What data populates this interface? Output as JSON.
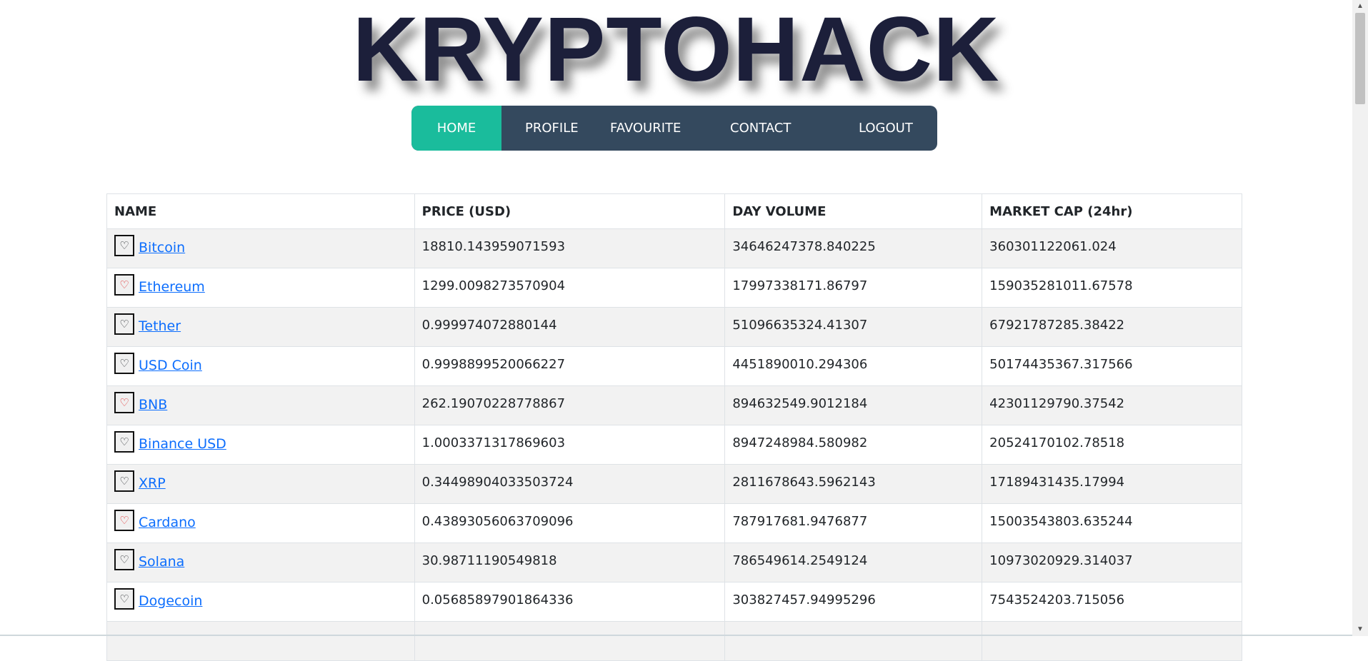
{
  "brand": {
    "logo_text": "KRYPTOHACK"
  },
  "nav": {
    "items": [
      {
        "label": "HOME",
        "active": true
      },
      {
        "label": "PROFILE",
        "active": false
      },
      {
        "label": "FAVOURITE",
        "active": false
      },
      {
        "label": "CONTACT",
        "active": false
      },
      {
        "label": "LOGOUT",
        "active": false
      }
    ],
    "bg_color": "#34495e",
    "active_color": "#1abc9c"
  },
  "table": {
    "headers": [
      "NAME",
      "PRICE (USD)",
      "DAY VOLUME",
      "MARKET CAP (24hr)"
    ],
    "rows": [
      {
        "name": "Bitcoin",
        "favourite": false,
        "price": "18810.143959071593",
        "volume": "34646247378.840225",
        "market_cap": "360301122061.024"
      },
      {
        "name": "Ethereum",
        "favourite": true,
        "price": "1299.0098273570904",
        "volume": "17997338171.86797",
        "market_cap": "159035281011.67578"
      },
      {
        "name": "Tether",
        "favourite": false,
        "price": "0.999974072880144",
        "volume": "51096635324.41307",
        "market_cap": "67921787285.38422"
      },
      {
        "name": "USD Coin",
        "favourite": false,
        "price": "0.9998899520066227",
        "volume": "4451890010.294306",
        "market_cap": "50174435367.317566"
      },
      {
        "name": "BNB",
        "favourite": true,
        "price": "262.19070228778867",
        "volume": "894632549.9012184",
        "market_cap": "42301129790.37542"
      },
      {
        "name": "Binance USD",
        "favourite": false,
        "price": "1.0003371317869603",
        "volume": "8947248984.580982",
        "market_cap": "20524170102.78518"
      },
      {
        "name": "XRP",
        "favourite": false,
        "price": "0.34498904033503724",
        "volume": "2811678643.5962143",
        "market_cap": "17189431435.17994"
      },
      {
        "name": "Cardano",
        "favourite": true,
        "price": "0.43893056063709096",
        "volume": "787917681.9476877",
        "market_cap": "15003543803.635244"
      },
      {
        "name": "Solana",
        "favourite": false,
        "price": "30.98711190549818",
        "volume": "786549614.2549124",
        "market_cap": "10973020929.314037"
      },
      {
        "name": "Dogecoin",
        "favourite": false,
        "price": "0.05685897901864336",
        "volume": "303827457.94995296",
        "market_cap": "7543524203.715056"
      }
    ]
  },
  "icons": {
    "favourite": "heart-icon"
  },
  "colors": {
    "link": "#0d6efd",
    "favourite_on": "#e02424",
    "logo": "#1c1f3a"
  }
}
